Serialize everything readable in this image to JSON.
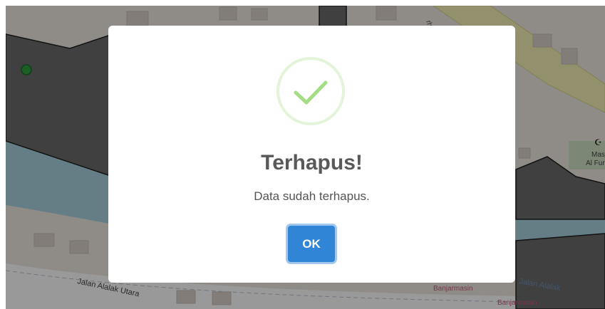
{
  "map": {
    "street_label_1": "Jalan Alalak Utara",
    "street_label_2": "Jalan Alalak",
    "street_label_3": "Banjarmasin",
    "street_label_4": "Banjarmasin",
    "street_label_5": "rhlas",
    "poi_label_1": "Masj",
    "poi_label_2": "Al Fur",
    "poi_icon": "mosque-icon",
    "marker_color": "#2e9e3e"
  },
  "modal": {
    "icon": "success-check-icon",
    "title": "Terhapus!",
    "message": "Data sudah terhapus.",
    "ok_label": "OK",
    "accent_color": "#3085d6",
    "check_color": "#a5dc86"
  }
}
